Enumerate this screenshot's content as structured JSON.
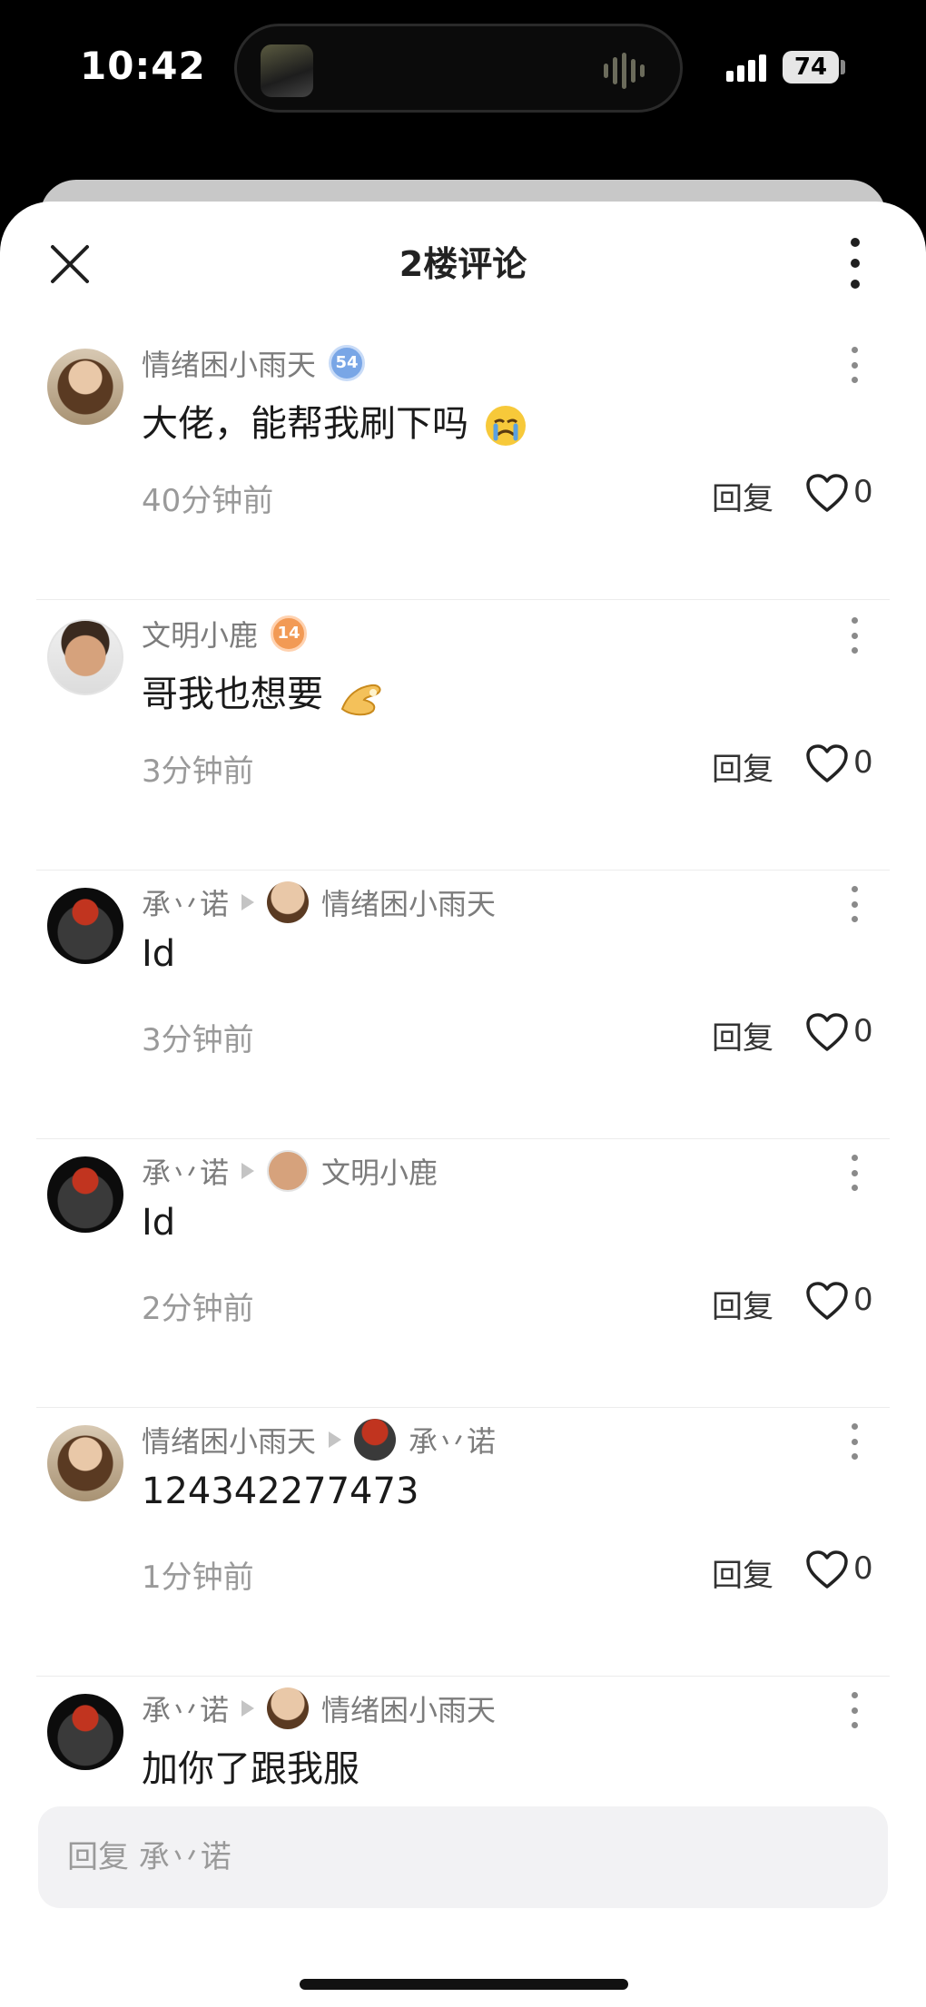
{
  "status_bar": {
    "time": "10:42",
    "battery": "74"
  },
  "header": {
    "title": "2楼评论"
  },
  "comments": [
    {
      "author": "情绪困小雨天",
      "level": "54",
      "text": "大佬，能帮我刷下吗",
      "time": "40分钟前",
      "reply_label": "回复",
      "likes": "0"
    },
    {
      "author": "文明小鹿",
      "level": "14",
      "text": "哥我也想要",
      "time": "3分钟前",
      "reply_label": "回复",
      "likes": "0"
    },
    {
      "author": "承丷诺",
      "reply_to": "情绪困小雨天",
      "text": "Id",
      "time": "3分钟前",
      "reply_label": "回复",
      "likes": "0"
    },
    {
      "author": "承丷诺",
      "reply_to": "文明小鹿",
      "text": "Id",
      "time": "2分钟前",
      "reply_label": "回复",
      "likes": "0"
    },
    {
      "author": "情绪困小雨天",
      "reply_to": "承丷诺",
      "text": "124342277473",
      "time": "1分钟前",
      "reply_label": "回复",
      "likes": "0"
    },
    {
      "author": "承丷诺",
      "reply_to": "情绪困小雨天",
      "text": "加你了跟我服"
    }
  ],
  "reply_input": {
    "placeholder": "回复 承丷诺"
  },
  "icons": {
    "close": "close-icon",
    "more": "more-vertical-icon",
    "heart": "heart-outline-icon",
    "reply_arrow": "triangle-right-icon",
    "emoji_crying": "crying-face-emoji",
    "emoji_pinch": "pinching-hand-emoji"
  },
  "colors": {
    "background": "#ffffff",
    "muted_text": "#7c7c7c",
    "input_bg": "#f2f2f4",
    "badge_blue": "#79a6e6",
    "badge_orange": "#f29a55"
  }
}
